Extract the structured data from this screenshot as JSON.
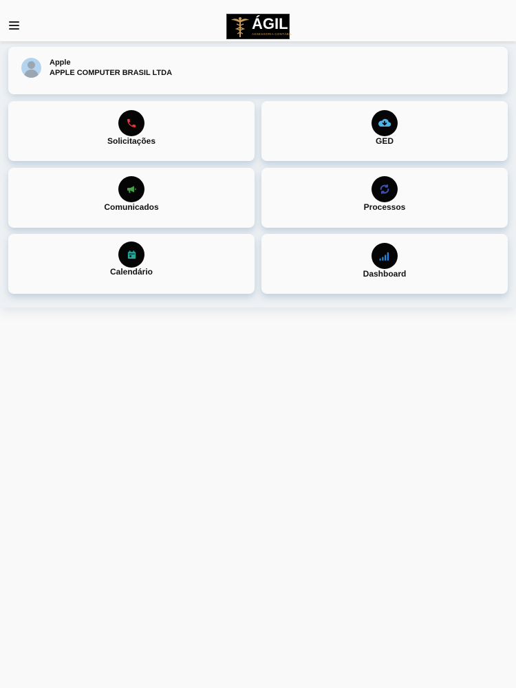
{
  "header": {
    "logo_title": "ÁGIL",
    "logo_subtitle": "ASSESSORIA CONTÁBIL"
  },
  "company": {
    "short_name": "Apple",
    "full_name": "APPLE COMPUTER BRASIL LTDA"
  },
  "tiles": [
    {
      "label": "Solicitações",
      "icon": "phone-icon",
      "color": "#e53935"
    },
    {
      "label": "GED",
      "icon": "cloud-download-icon",
      "color": "#4fb3e8"
    },
    {
      "label": "Comunicados",
      "icon": "megaphone-icon",
      "color": "#43a047"
    },
    {
      "label": "Processos",
      "icon": "refresh-icon",
      "color": "#3f51b5"
    },
    {
      "label": "Calendário",
      "icon": "calendar-icon",
      "color": "#26a69a"
    },
    {
      "label": "Dashboard",
      "icon": "signal-bars-icon",
      "color": "#1e88e5"
    }
  ]
}
